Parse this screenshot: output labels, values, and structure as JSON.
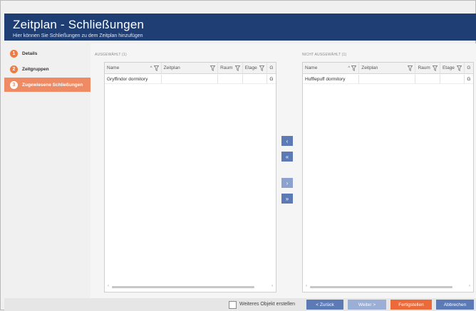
{
  "header": {
    "title": "Zeitplan - Schließungen",
    "subtitle": "Hier können Sie Schließungen zu dem Zeitplan hinzufügen"
  },
  "steps": [
    {
      "number": "1",
      "label": "Details",
      "active": false
    },
    {
      "number": "2",
      "label": "Zeitgruppen",
      "active": false
    },
    {
      "number": "3",
      "label": "Zugewiesene Schließungen",
      "active": true
    }
  ],
  "selected": {
    "label": "AUSGEWÄHLT (1)",
    "columns": [
      "Name",
      "Zeitplan",
      "Raum",
      "Etage",
      "G"
    ],
    "rows": [
      [
        "Gryffindor dormitory",
        "",
        "",
        "",
        "G"
      ]
    ]
  },
  "unselected": {
    "label": "NICHT AUSGEWÄHLT (1)",
    "columns": [
      "Name",
      "Zeitplan",
      "Raum",
      "Etage",
      "G"
    ],
    "rows": [
      [
        "Hufflepuff dormitory",
        "",
        "",
        "",
        "G"
      ]
    ]
  },
  "movers": {
    "left_one": "‹",
    "left_all": "«",
    "right_one": "›",
    "right_all": "»"
  },
  "footer": {
    "another_object": "Weiteres Objekt erstellen",
    "back": "< Zurück",
    "next": "Weiter >",
    "finish": "Fertigstellen",
    "cancel": "Abbrechen"
  },
  "colors": {
    "header_bg": "#1f3e73",
    "accent_orange": "#ec6a3a",
    "accent_blue": "#5b7ab6"
  }
}
